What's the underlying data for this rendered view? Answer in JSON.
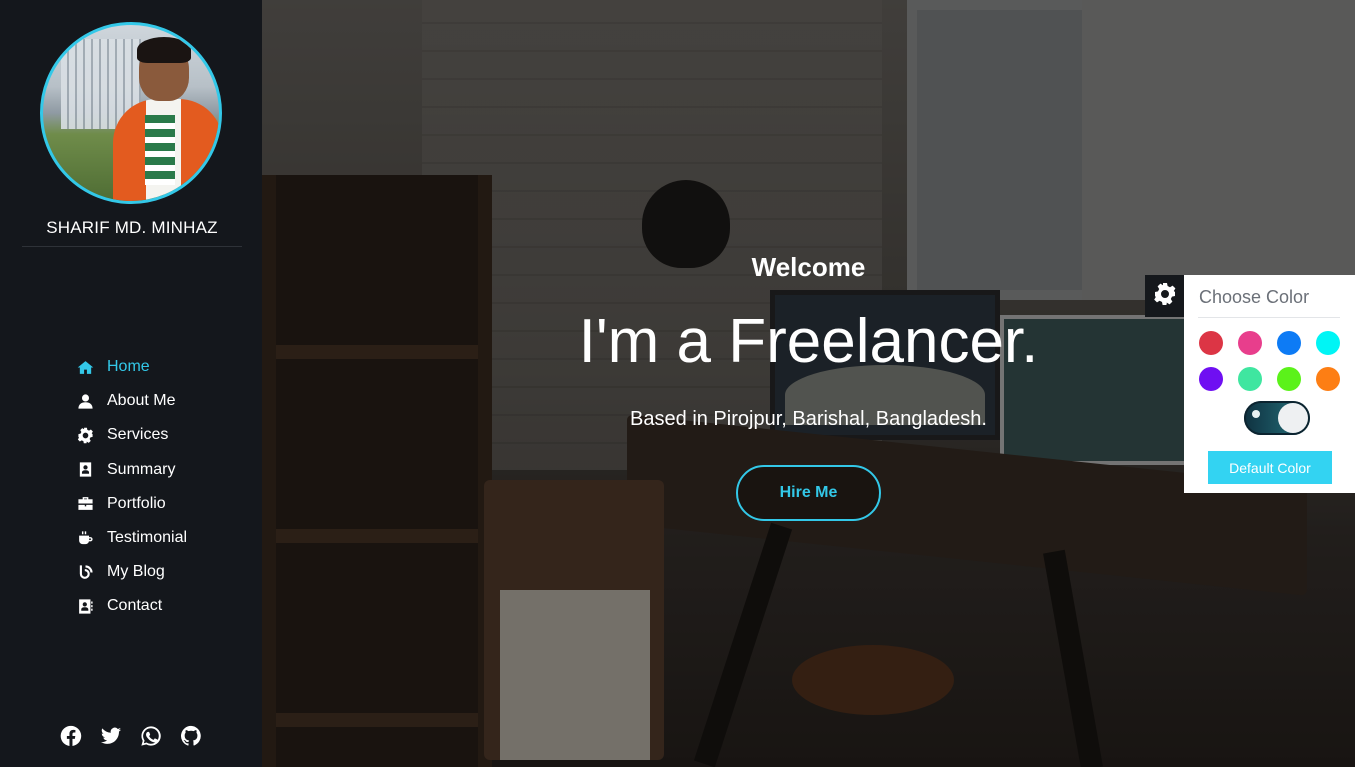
{
  "profile": {
    "name": "SHARIF MD. MINHAZ"
  },
  "nav": {
    "items": [
      {
        "label": "Home",
        "icon": "home-icon",
        "active": true
      },
      {
        "label": "About Me",
        "icon": "user-icon",
        "active": false
      },
      {
        "label": "Services",
        "icon": "gear-icon",
        "active": false
      },
      {
        "label": "Summary",
        "icon": "id-card-icon",
        "active": false
      },
      {
        "label": "Portfolio",
        "icon": "briefcase-icon",
        "active": false
      },
      {
        "label": "Testimonial",
        "icon": "coffee-icon",
        "active": false
      },
      {
        "label": "My Blog",
        "icon": "blog-icon",
        "active": false
      },
      {
        "label": "Contact",
        "icon": "address-book-icon",
        "active": false
      }
    ]
  },
  "social": [
    "facebook-icon",
    "twitter-icon",
    "whatsapp-icon",
    "github-icon"
  ],
  "hero": {
    "welcome": "Welcome",
    "headline": "I'm a Freelancer.",
    "subline": "Based in Pirojpur, Barishal, Bangladesh.",
    "cta": "Hire Me"
  },
  "color_panel": {
    "title": "Choose Color",
    "swatches": [
      "#dc3545",
      "#e83e8c",
      "#0d7bf5",
      "#00f5f5",
      "#6f0ff2",
      "#3fe6a0",
      "#5bf21a",
      "#fd7e14"
    ],
    "default_button": "Default Color",
    "dark_mode_toggle": "on"
  },
  "colors": {
    "accent": "#33c8e8",
    "sidebar_bg": "#14171c"
  }
}
